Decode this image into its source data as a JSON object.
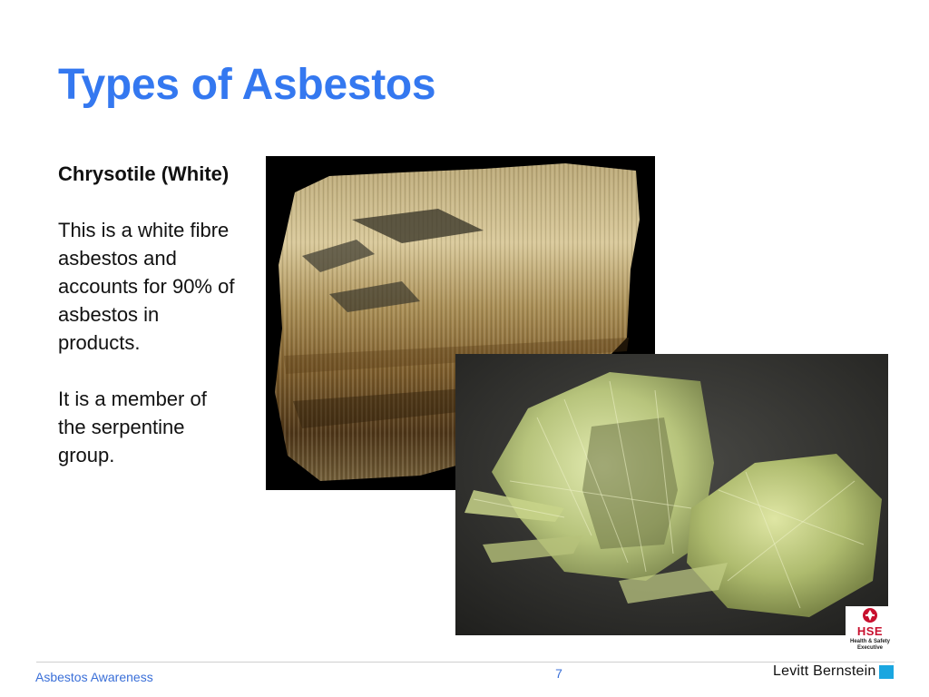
{
  "slide": {
    "title": "Types of Asbestos",
    "heading": "Chrysotile (White)",
    "paragraph1": "This is a white fibre asbestos and accounts for 90% of asbestos in products.",
    "paragraph2": "It is a member of the serpentine group."
  },
  "logo": {
    "main": "HSE",
    "sub_line1": "Health & Safety",
    "sub_line2": "Executive"
  },
  "footer": {
    "left_text": "Asbestos Awareness",
    "page_number": "7",
    "brand": "Levitt Bernstein"
  },
  "colors": {
    "title": "#3478f0",
    "footer_text": "#3a6fd8",
    "brand_accent": "#1aa6e0",
    "hse_red": "#c8102e"
  }
}
